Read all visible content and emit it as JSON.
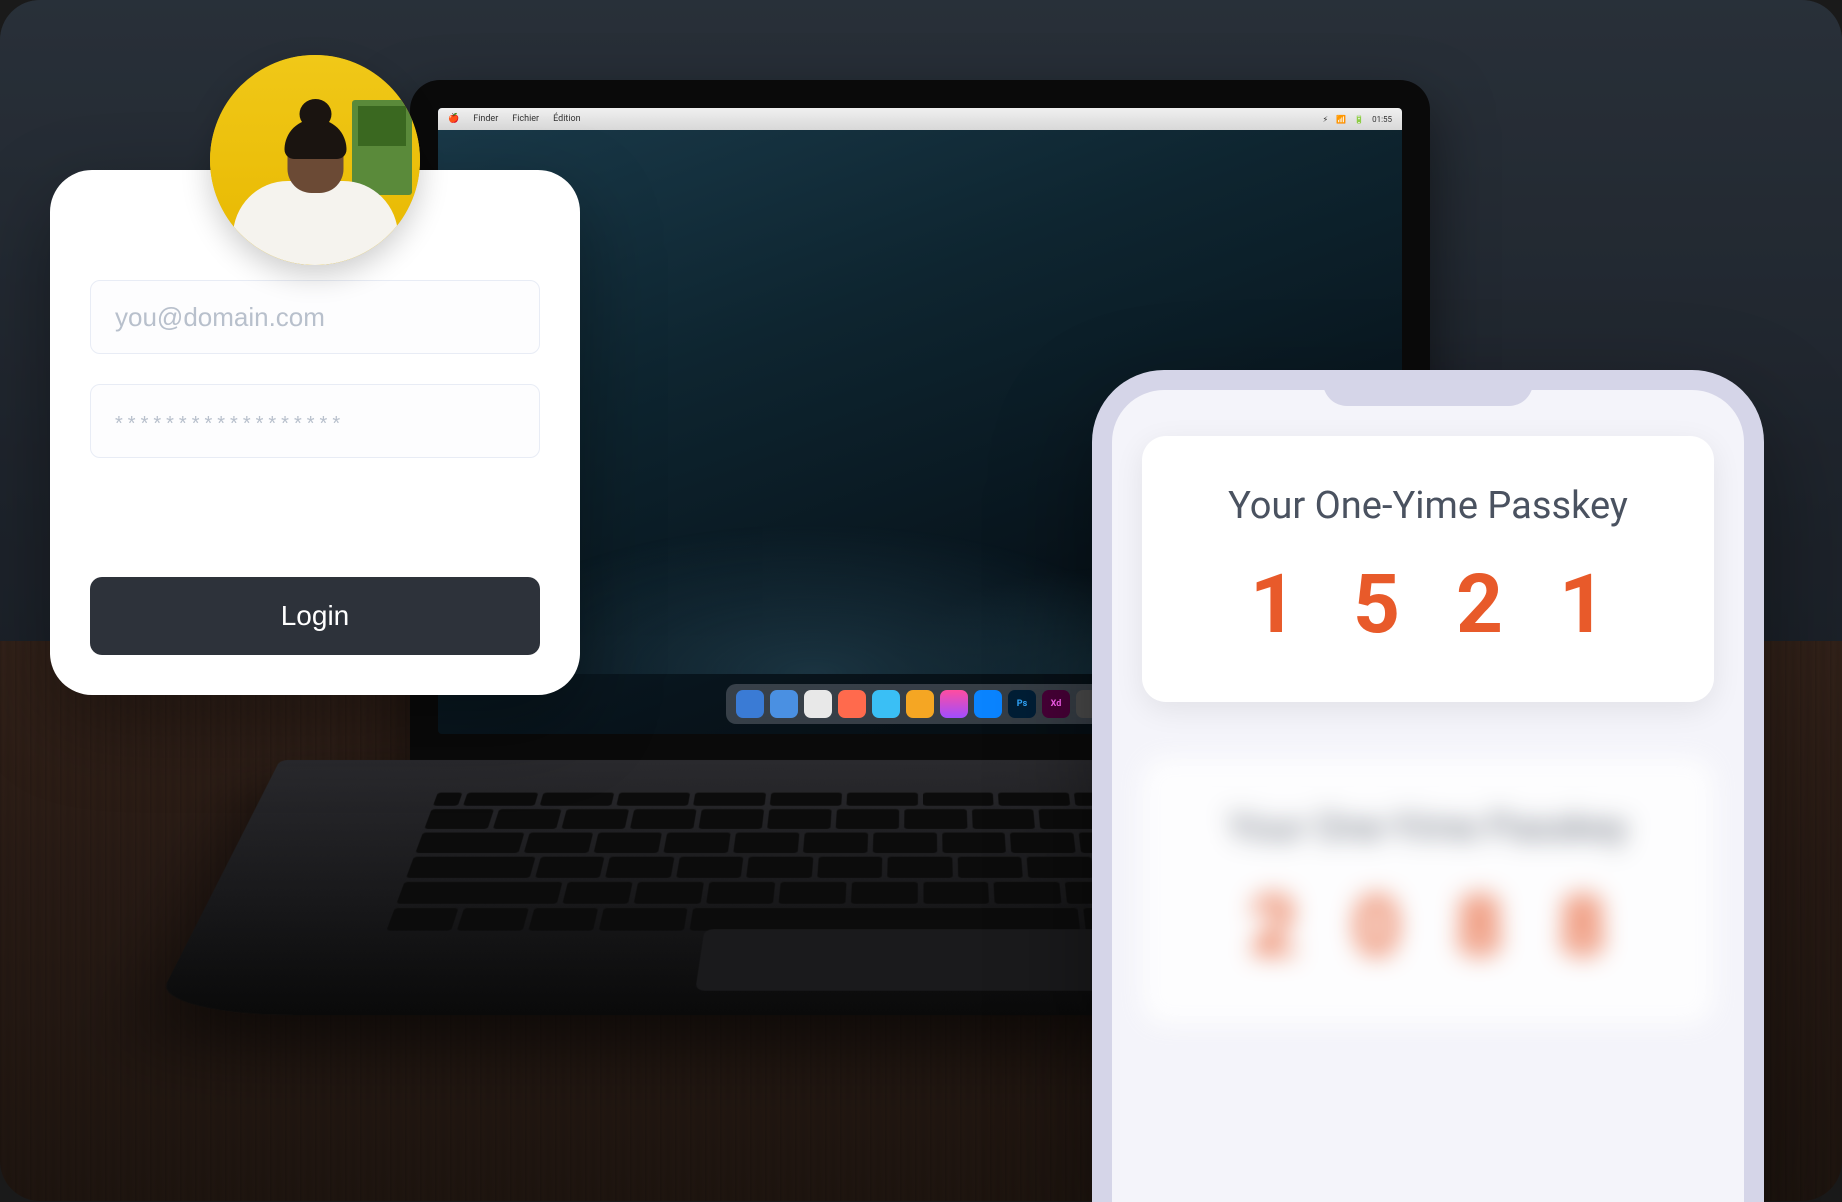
{
  "login": {
    "email_placeholder": "you@domain.com",
    "password_placeholder": "******************",
    "button_label": "Login"
  },
  "passkey": {
    "title": "Your One-Yime Passkey",
    "digits": [
      "1",
      "5",
      "2",
      "1"
    ]
  },
  "passkey_prev": {
    "title": "Your One-Yime Passkey",
    "digits": [
      "2",
      "0",
      "8",
      "8"
    ]
  },
  "colors": {
    "accent": "#e85a2a",
    "button": "#2d323a"
  }
}
